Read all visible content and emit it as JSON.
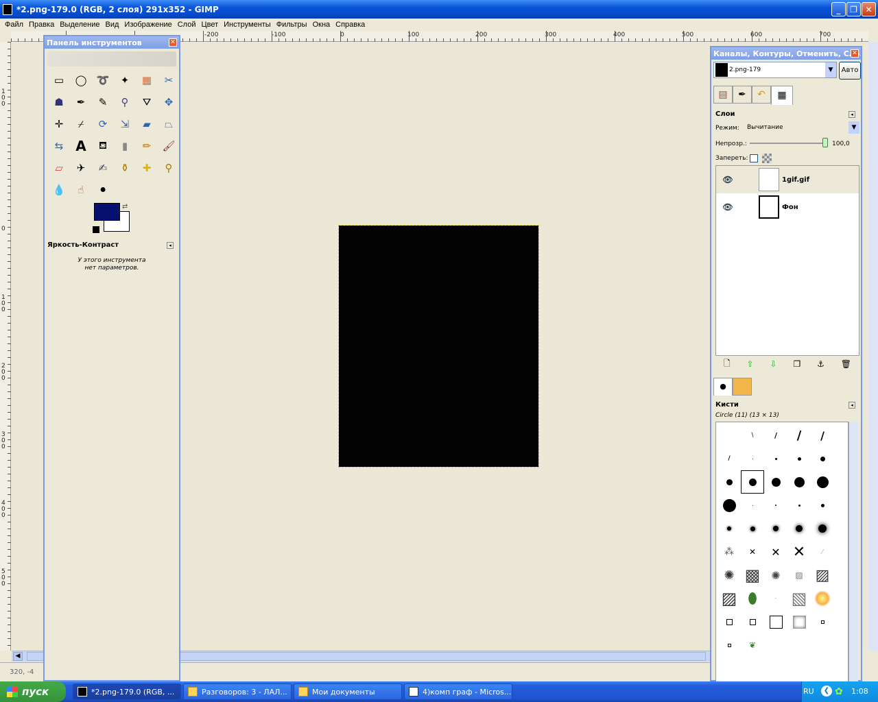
{
  "window": {
    "title": "*2.png-179.0 (RGB, 2 слоя) 291x352 - GIMP"
  },
  "menu": [
    "Файл",
    "Правка",
    "Выделение",
    "Вид",
    "Изображение",
    "Слой",
    "Цвет",
    "Инструменты",
    "Фильтры",
    "Окна",
    "Справка"
  ],
  "ruler_top": [
    "-200",
    "-100",
    "0",
    "100",
    "200",
    "300",
    "400",
    "500",
    "600",
    "700"
  ],
  "ruler_left": [
    "1\n0\n0",
    "0",
    "1\n0\n0",
    "2\n0\n0",
    "3\n0\n0",
    "4\n0\n0",
    "5\n0\n0"
  ],
  "status": {
    "coords": "320, -4"
  },
  "toolbox": {
    "title": "Панель инструментов",
    "fg_color": "#06106e",
    "bg_color": "#ffffff",
    "tool_options_title": "Яркость-Контраст",
    "tool_options_text1": "У этого инструмента",
    "tool_options_text2": "нет параметров."
  },
  "dock": {
    "title": "Каналы, Контуры, Отменить, Сло...",
    "image_select": "2.png-179",
    "auto_button": "Авто",
    "layers_title": "Слои",
    "mode_label": "Режим:",
    "mode_value": "Вычитание",
    "opacity_label": "Непрозр.:",
    "opacity_value": "100,0",
    "lock_label": "Запереть:",
    "layers": [
      {
        "name": "1gif.gif"
      },
      {
        "name": "Фон"
      }
    ],
    "brushes_title": "Кисти",
    "brush_name": "Circle (11) (13 × 13)"
  },
  "taskbar": {
    "start": "пуск",
    "tasks": [
      "*2.png-179.0 (RGB, ...",
      "Разговоров: 3 - ЛАЛ...",
      "Мои документы",
      "4)комп граф - Micros..."
    ],
    "lang": "RU",
    "time": "1:08"
  }
}
